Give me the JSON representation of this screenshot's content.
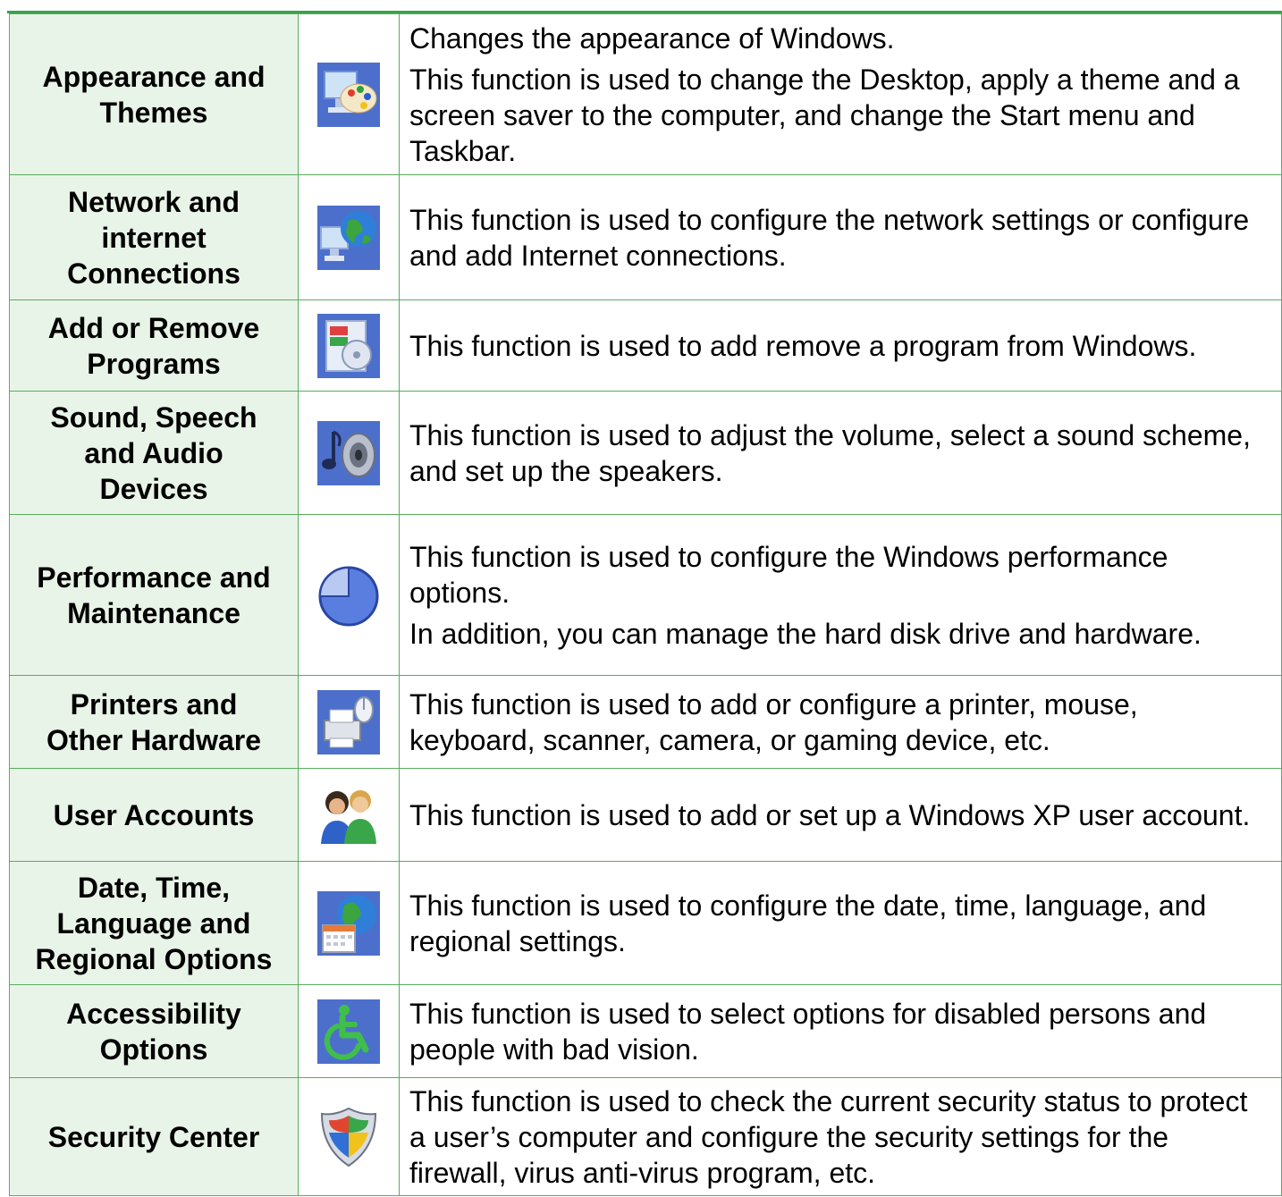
{
  "rows": [
    {
      "name": "Appearance and Themes",
      "icon": "appearance-themes-icon",
      "paragraphs": [
        "Changes the appearance of Windows.",
        "This function is used to change the Desktop, apply a theme and a screen saver to the computer, and change the Start menu and Taskbar."
      ]
    },
    {
      "name": "Network and internet Connections",
      "icon": "network-connections-icon",
      "paragraphs": [
        "This function is used to configure the network settings or configure and add Internet connections."
      ]
    },
    {
      "name": "Add or Remove Programs",
      "icon": "add-remove-programs-icon",
      "paragraphs": [
        "This function is used to add remove a program from Windows."
      ]
    },
    {
      "name": "Sound, Speech and Audio Devices",
      "icon": "sound-devices-icon",
      "paragraphs": [
        "This function is used to adjust the volume, select a sound scheme, and set up the speakers."
      ]
    },
    {
      "name": "Performance and Maintenance",
      "icon": "performance-maintenance-icon",
      "paragraphs": [
        "This function is used to configure the Windows performance options.",
        "In addition, you can manage the hard disk drive and hardware."
      ]
    },
    {
      "name": "Printers and Other Hardware",
      "icon": "printers-hardware-icon",
      "paragraphs": [
        "This function is used to add or configure a printer, mouse, keyboard, scanner, camera, or gaming device, etc."
      ]
    },
    {
      "name": "User Accounts",
      "icon": "user-accounts-icon",
      "paragraphs": [
        "This function is used to add or set up a Windows XP user account."
      ]
    },
    {
      "name": "Date, Time, Language and Regional Options",
      "icon": "date-time-language-icon",
      "paragraphs": [
        "This function is used to configure the date, time, language, and regional settings."
      ]
    },
    {
      "name": "Accessibility Options",
      "icon": "accessibility-icon",
      "paragraphs": [
        "This function is used to select options for disabled persons and people with bad vision."
      ]
    },
    {
      "name": "Security Center",
      "icon": "security-center-icon",
      "paragraphs": [
        "This function is used to check the current security status to protect a user’s computer and configure the security settings for the firewall, virus anti-virus program, etc."
      ]
    }
  ]
}
